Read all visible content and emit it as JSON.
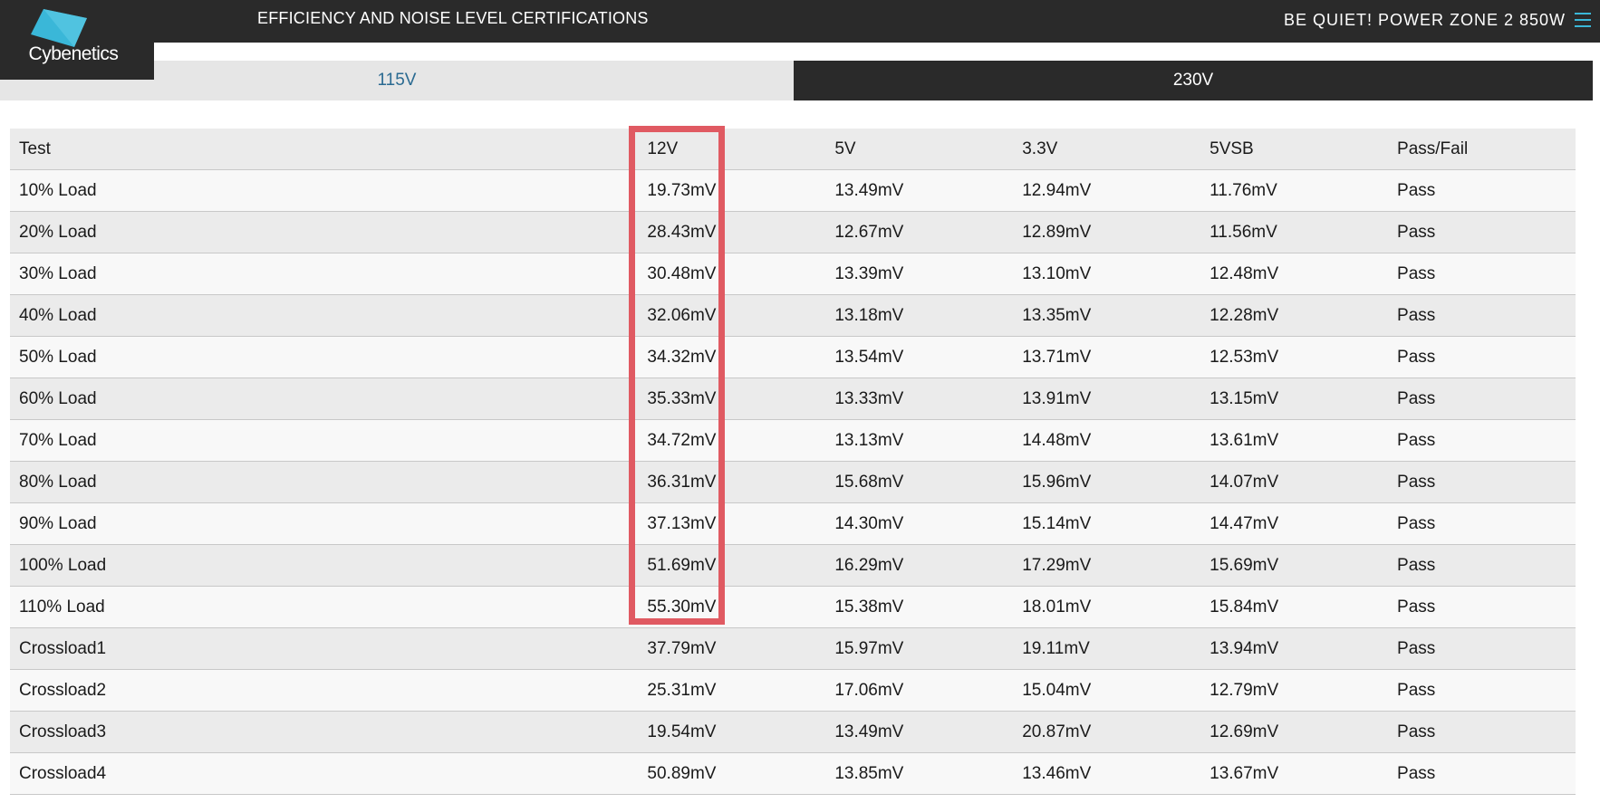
{
  "header": {
    "logo_text": "Cybenetics",
    "page_heading": "EFFICIENCY AND NOISE LEVEL CERTIFICATIONS",
    "product_title": "BE QUIET! POWER ZONE 2 850W",
    "menu_icon": "hamburger-menu-icon",
    "accent_color": "#3ab7d8"
  },
  "tabs": [
    {
      "label": "115V",
      "active": false
    },
    {
      "label": "230V",
      "active": true
    }
  ],
  "table": {
    "columns": [
      "Test",
      "12V",
      "5V",
      "3.3V",
      "5VSB",
      "Pass/Fail"
    ],
    "rows": [
      [
        "10% Load",
        "19.73mV",
        "13.49mV",
        "12.94mV",
        "11.76mV",
        "Pass"
      ],
      [
        "20% Load",
        "28.43mV",
        "12.67mV",
        "12.89mV",
        "11.56mV",
        "Pass"
      ],
      [
        "30% Load",
        "30.48mV",
        "13.39mV",
        "13.10mV",
        "12.48mV",
        "Pass"
      ],
      [
        "40% Load",
        "32.06mV",
        "13.18mV",
        "13.35mV",
        "12.28mV",
        "Pass"
      ],
      [
        "50% Load",
        "34.32mV",
        "13.54mV",
        "13.71mV",
        "12.53mV",
        "Pass"
      ],
      [
        "60% Load",
        "35.33mV",
        "13.33mV",
        "13.91mV",
        "13.15mV",
        "Pass"
      ],
      [
        "70% Load",
        "34.72mV",
        "13.13mV",
        "14.48mV",
        "13.61mV",
        "Pass"
      ],
      [
        "80% Load",
        "36.31mV",
        "15.68mV",
        "15.96mV",
        "14.07mV",
        "Pass"
      ],
      [
        "90% Load",
        "37.13mV",
        "14.30mV",
        "15.14mV",
        "14.47mV",
        "Pass"
      ],
      [
        "100% Load",
        "51.69mV",
        "16.29mV",
        "17.29mV",
        "15.69mV",
        "Pass"
      ],
      [
        "110% Load",
        "55.30mV",
        "15.38mV",
        "18.01mV",
        "15.84mV",
        "Pass"
      ],
      [
        "Crossload1",
        "37.79mV",
        "15.97mV",
        "19.11mV",
        "13.94mV",
        "Pass"
      ],
      [
        "Crossload2",
        "25.31mV",
        "17.06mV",
        "15.04mV",
        "12.79mV",
        "Pass"
      ],
      [
        "Crossload3",
        "19.54mV",
        "13.49mV",
        "20.87mV",
        "12.69mV",
        "Pass"
      ],
      [
        "Crossload4",
        "50.89mV",
        "13.85mV",
        "13.46mV",
        "13.67mV",
        "Pass"
      ]
    ]
  },
  "highlight": {
    "color": "#e05a62",
    "column": "12V"
  },
  "colors": {
    "header_bg": "#2a2a2a",
    "tab_inactive_bg": "#e6e6e6",
    "tab_inactive_text": "#2a6a91",
    "row_odd_bg": "#ebebeb",
    "row_even_bg": "#f8f8f8"
  }
}
